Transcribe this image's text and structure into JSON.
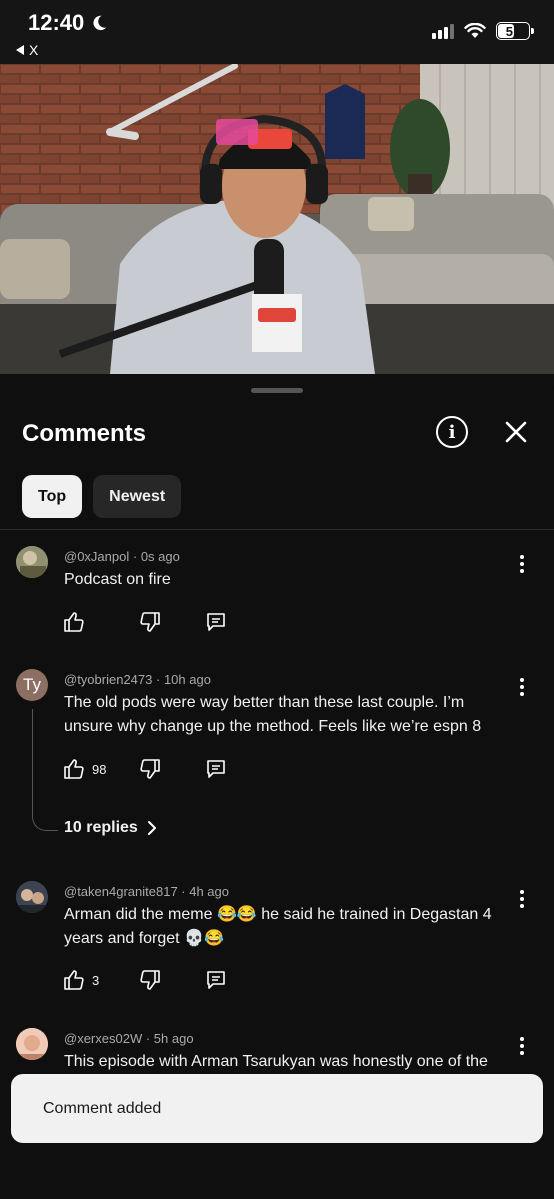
{
  "status_bar": {
    "time": "12:40",
    "back_label": "X",
    "battery": "51"
  },
  "comments_panel": {
    "title": "Comments",
    "tabs": [
      {
        "label": "Top",
        "active": true
      },
      {
        "label": "Newest",
        "active": false
      }
    ],
    "comments": [
      {
        "author": "@0xJanpol",
        "time": "0s ago",
        "text": "Podcast on fire",
        "likes": ""
      },
      {
        "author": "@tyobrien2473",
        "time": "10h ago",
        "text": "The old pods were way better than these last couple. I’m unsure why change up the method. Feels like we’re espn 8",
        "likes": "98",
        "avatar_initials": "Ty",
        "replies": "10 replies"
      },
      {
        "author": "@taken4granite817",
        "time": "4h ago",
        "text": "Arman did the meme 😂😂 he said he trained in Degastan 4 years and forget 💀😂",
        "likes": "3"
      },
      {
        "author": "@xerxes02W",
        "time": "5h ago",
        "text": "This episode with Arman Tsarukyan was honestly one of the"
      }
    ]
  },
  "toast": {
    "text": "Comment added"
  },
  "colors": {
    "background": "#0f0f0f",
    "chip_active": "#f1f1f1",
    "chip_inactive": "#272727",
    "ty_avatar": "#8d6e63"
  },
  "icons": [
    "moon-icon",
    "signal-icon",
    "wifi-icon",
    "battery-icon",
    "info-icon",
    "close-icon",
    "like-icon",
    "dislike-icon",
    "reply-icon",
    "more-icon",
    "chevron-right-icon"
  ]
}
